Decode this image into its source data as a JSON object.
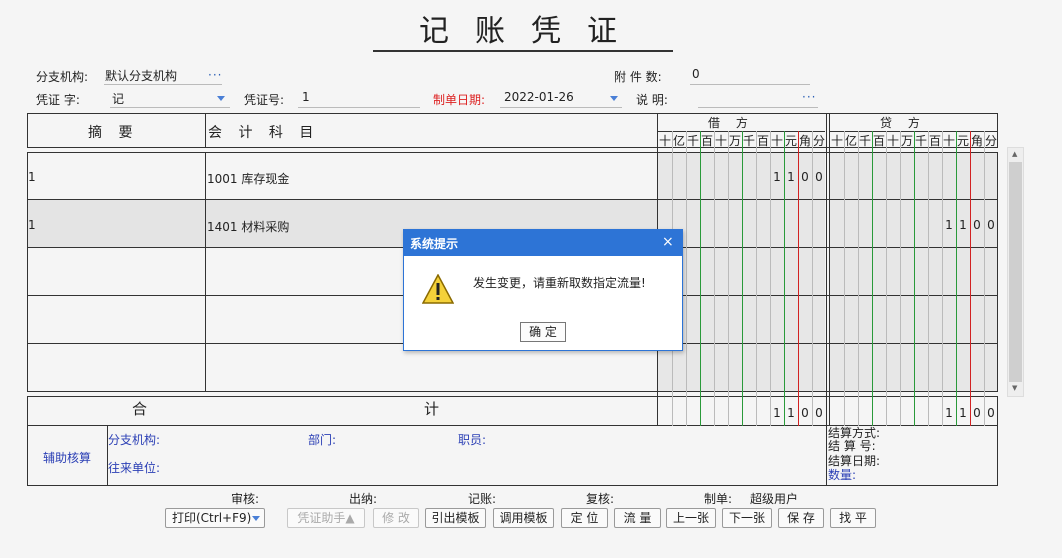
{
  "title": "记账凭证",
  "header": {
    "branch_label": "分支机构:",
    "branch_value": "默认分支机构",
    "branch_more": "···",
    "attach_label": "附 件 数:",
    "attach_value": "0",
    "voucher_word_label": "凭证  字:",
    "voucher_word_value": "记",
    "voucher_no_label": "凭证号:",
    "voucher_no_value": "1",
    "date_label": "制单日期:",
    "date_value": "2022-01-26",
    "desc_label": "说  明:",
    "desc_value": "",
    "desc_more": "···"
  },
  "table": {
    "col_summary": "摘   要",
    "col_account": "会  计  科  目",
    "debit_label": "借   方",
    "credit_label": "贷   方",
    "digit_headers": [
      "十",
      "亿",
      "千",
      "百",
      "十",
      "万",
      "千",
      "百",
      "十",
      "元",
      "角",
      "分"
    ],
    "rows": [
      {
        "summary": "1",
        "account": "1001  库存现金",
        "debit": "1100",
        "credit": ""
      },
      {
        "summary": "1",
        "account": "1401  材料采购",
        "debit": "",
        "credit": "1100"
      },
      {
        "summary": "",
        "account": "",
        "debit": "",
        "credit": ""
      },
      {
        "summary": "",
        "account": "",
        "debit": "",
        "credit": ""
      },
      {
        "summary": "",
        "account": "",
        "debit": "",
        "credit": ""
      }
    ],
    "total_he": "合",
    "total_ji": "计",
    "total_debit": "1100",
    "total_credit": "1100"
  },
  "aux": {
    "title": "辅助核算",
    "branch": "分支机构:",
    "dept": "部门:",
    "staff": "职员:",
    "contact": "往来单位:",
    "settle_method": "结算方式:",
    "settle_no": "结  算 号:",
    "settle_date": "结算日期:",
    "quantity": "数量:"
  },
  "footer": {
    "audit": "审核:",
    "cashier": "出纳:",
    "posting": "记账:",
    "review": "复核:",
    "maker_label": "制单:",
    "maker_value": "超级用户"
  },
  "buttons": {
    "print": "打印(Ctrl+F9)",
    "assist": "凭证助手▲",
    "modify": "修 改",
    "export_tpl": "引出模板",
    "load_tpl": "调用模板",
    "locate": "定 位",
    "flow": "流 量",
    "prev": "上一张",
    "next": "下一张",
    "save": "保 存",
    "balance": "找 平"
  },
  "dialog": {
    "title": "系统提示",
    "close": "×",
    "message": "发生变更，请重新取数指定流量!",
    "ok": "确 定"
  },
  "colors": {
    "dialog_blue": "#2d74d6",
    "green_line": "#2a9a3a",
    "red_line": "#d22222"
  }
}
